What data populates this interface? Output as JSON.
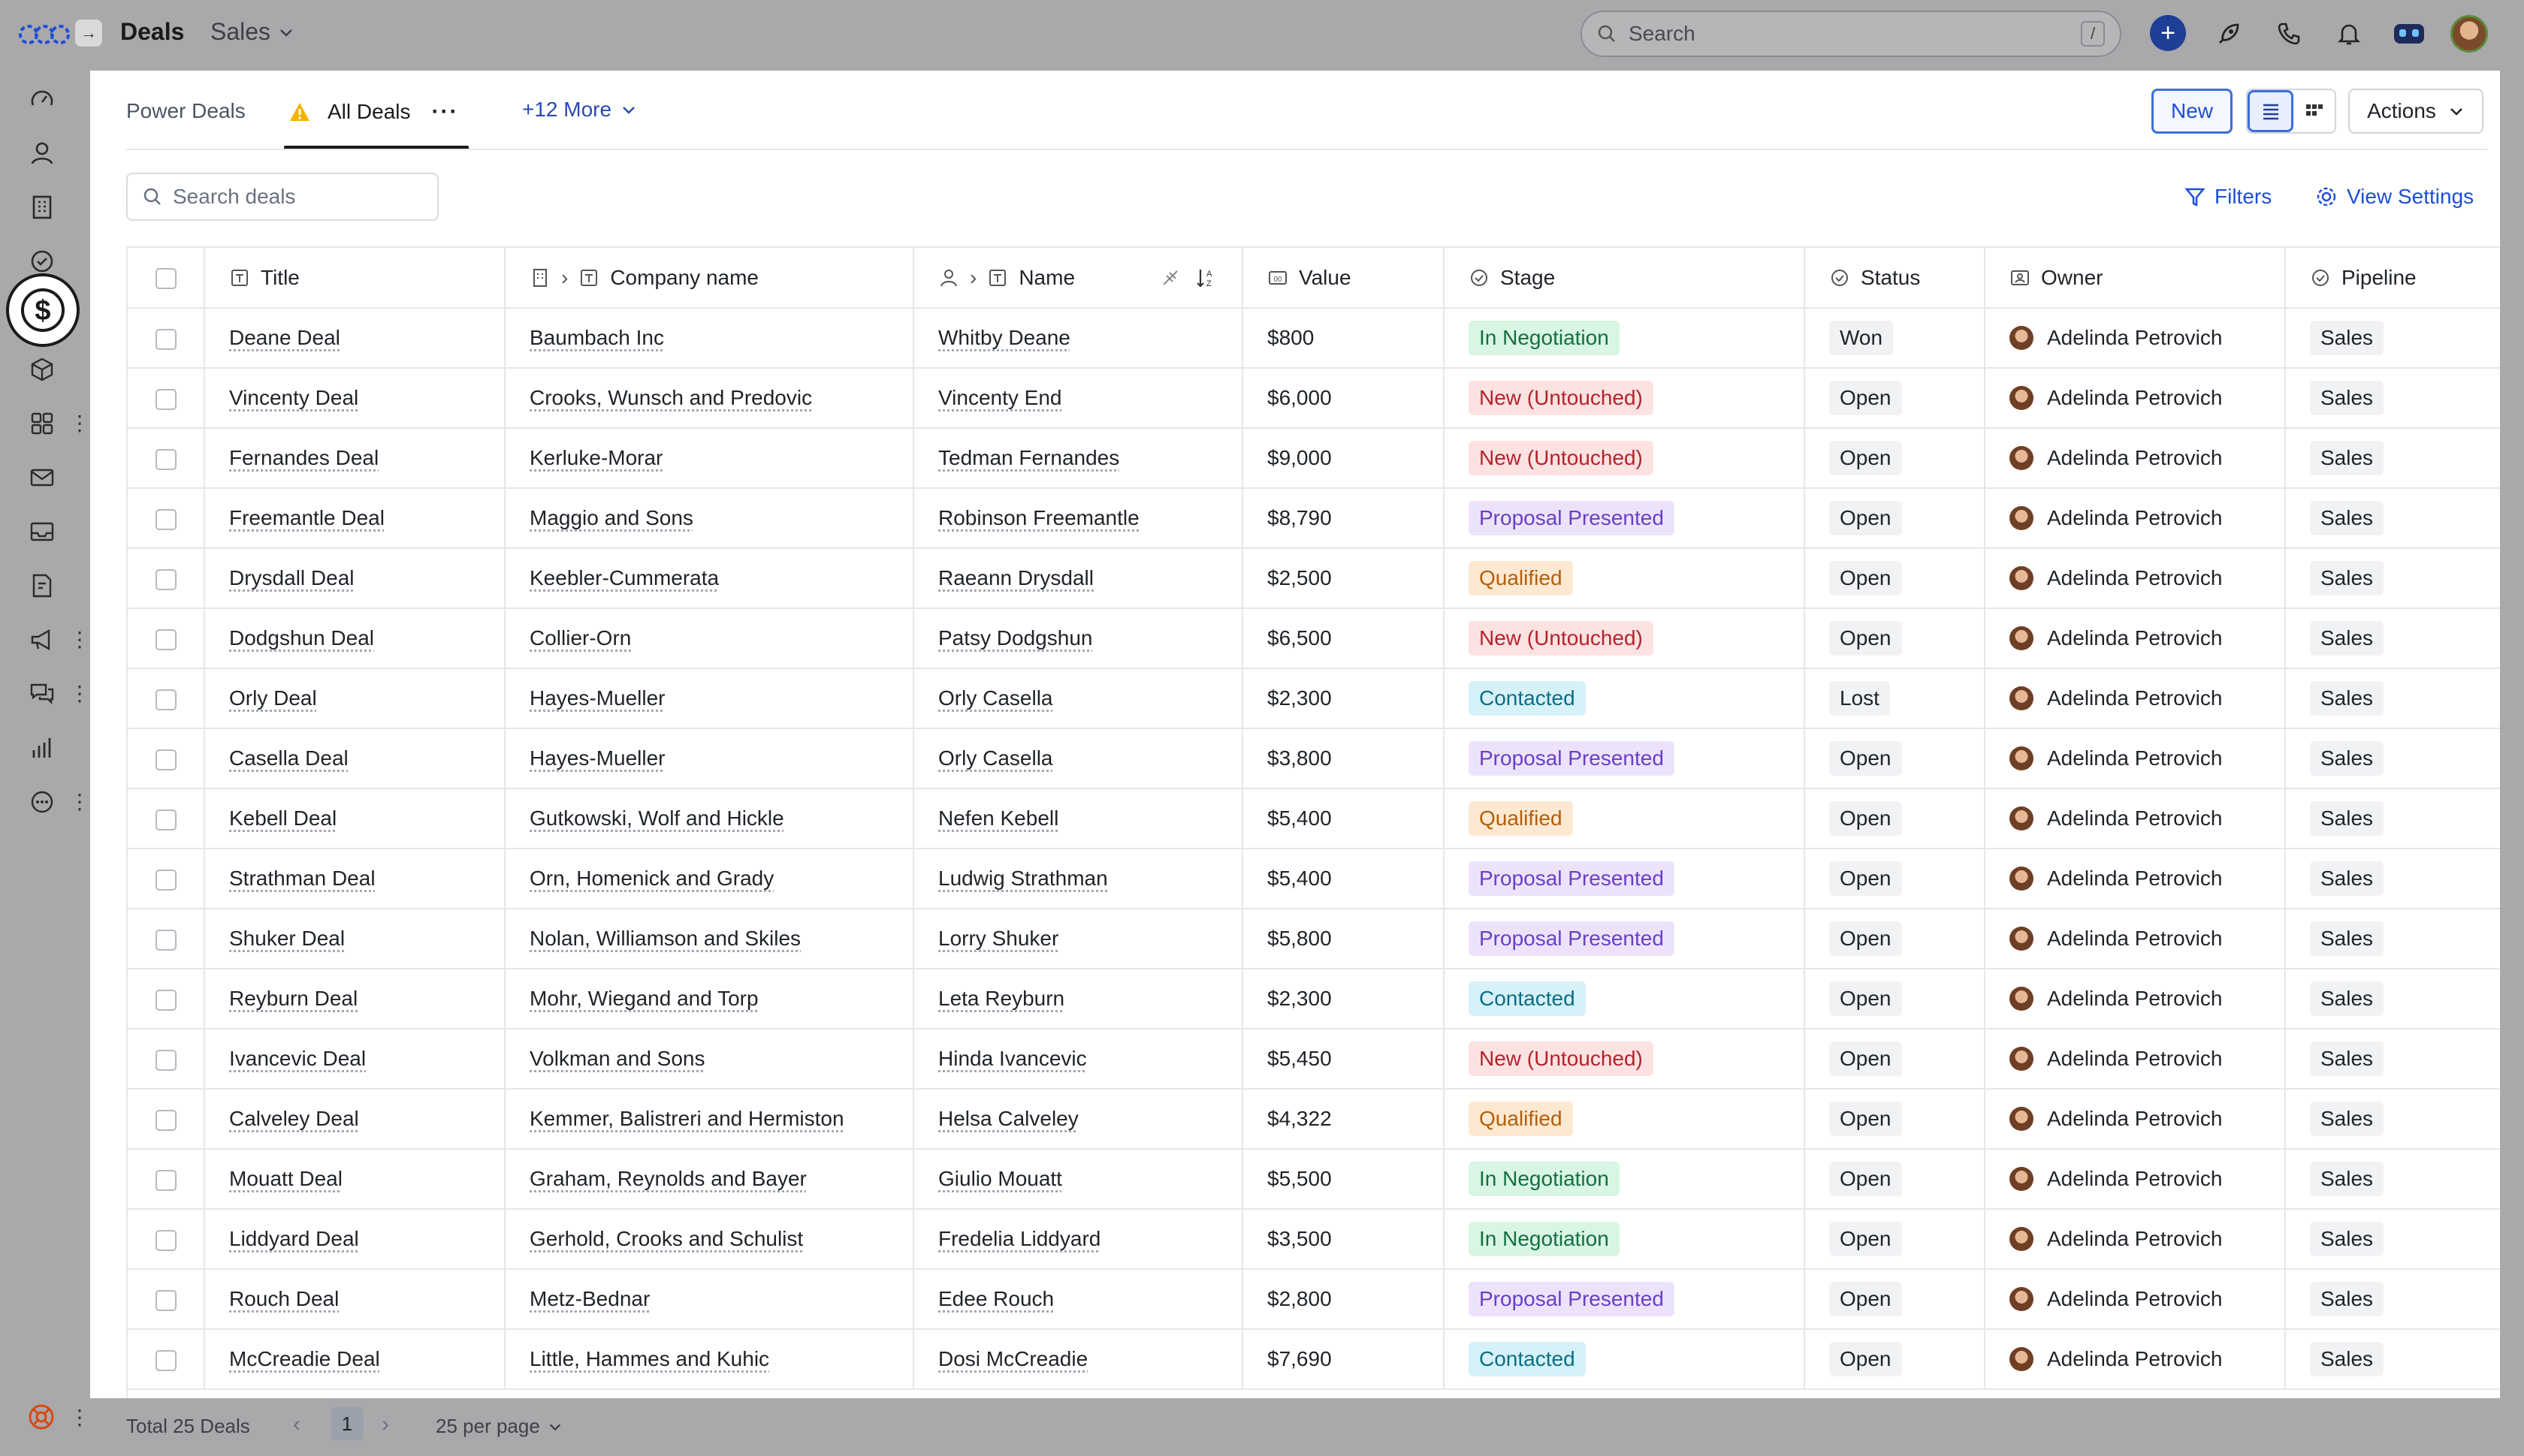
{
  "header": {
    "title": "Deals",
    "workspace": "Sales",
    "search_placeholder": "Search",
    "search_shortcut": "/"
  },
  "tabs": {
    "items": [
      {
        "label": "Power Deals"
      },
      {
        "label": "All Deals"
      }
    ],
    "more_label": "+12 More"
  },
  "toolbar": {
    "new_label": "New",
    "actions_label": "Actions",
    "search_placeholder": "Search deals",
    "filters_label": "Filters",
    "view_settings_label": "View Settings"
  },
  "table": {
    "columns": [
      "Title",
      "Company name",
      "Name",
      "Value",
      "Stage",
      "Status",
      "Owner",
      "Pipeline"
    ],
    "rows": [
      {
        "title": "Deane Deal",
        "company": "Baumbach Inc",
        "name": "Whitby Deane",
        "value": "$800",
        "stage": "In Negotiation",
        "status": "Won",
        "owner": "Adelinda Petrovich",
        "pipeline": "Sales"
      },
      {
        "title": "Vincenty Deal",
        "company": "Crooks, Wunsch and Predovic",
        "name": "Vincenty End",
        "value": "$6,000",
        "stage": "New (Untouched)",
        "status": "Open",
        "owner": "Adelinda Petrovich",
        "pipeline": "Sales"
      },
      {
        "title": "Fernandes Deal",
        "company": "Kerluke-Morar",
        "name": "Tedman Fernandes",
        "value": "$9,000",
        "stage": "New (Untouched)",
        "status": "Open",
        "owner": "Adelinda Petrovich",
        "pipeline": "Sales"
      },
      {
        "title": "Freemantle Deal",
        "company": "Maggio and Sons",
        "name": "Robinson Freemantle",
        "value": "$8,790",
        "stage": "Proposal Presented",
        "status": "Open",
        "owner": "Adelinda Petrovich",
        "pipeline": "Sales"
      },
      {
        "title": "Drysdall Deal",
        "company": "Keebler-Cummerata",
        "name": "Raeann Drysdall",
        "value": "$2,500",
        "stage": "Qualified",
        "status": "Open",
        "owner": "Adelinda Petrovich",
        "pipeline": "Sales"
      },
      {
        "title": "Dodgshun Deal",
        "company": "Collier-Orn",
        "name": "Patsy Dodgshun",
        "value": "$6,500",
        "stage": "New (Untouched)",
        "status": "Open",
        "owner": "Adelinda Petrovich",
        "pipeline": "Sales"
      },
      {
        "title": "Orly Deal",
        "company": "Hayes-Mueller",
        "name": "Orly Casella",
        "value": "$2,300",
        "stage": "Contacted",
        "status": "Lost",
        "owner": "Adelinda Petrovich",
        "pipeline": "Sales"
      },
      {
        "title": "Casella Deal",
        "company": "Hayes-Mueller",
        "name": "Orly Casella",
        "value": "$3,800",
        "stage": "Proposal Presented",
        "status": "Open",
        "owner": "Adelinda Petrovich",
        "pipeline": "Sales"
      },
      {
        "title": "Kebell Deal",
        "company": "Gutkowski, Wolf and Hickle",
        "name": "Nefen Kebell",
        "value": "$5,400",
        "stage": "Qualified",
        "status": "Open",
        "owner": "Adelinda Petrovich",
        "pipeline": "Sales"
      },
      {
        "title": "Strathman Deal",
        "company": "Orn, Homenick and Grady",
        "name": "Ludwig Strathman",
        "value": "$5,400",
        "stage": "Proposal Presented",
        "status": "Open",
        "owner": "Adelinda Petrovich",
        "pipeline": "Sales"
      },
      {
        "title": "Shuker Deal",
        "company": "Nolan, Williamson and Skiles",
        "name": "Lorry Shuker",
        "value": "$5,800",
        "stage": "Proposal Presented",
        "status": "Open",
        "owner": "Adelinda Petrovich",
        "pipeline": "Sales"
      },
      {
        "title": "Reyburn Deal",
        "company": "Mohr, Wiegand and Torp",
        "name": "Leta Reyburn",
        "value": "$2,300",
        "stage": "Contacted",
        "status": "Open",
        "owner": "Adelinda Petrovich",
        "pipeline": "Sales"
      },
      {
        "title": "Ivancevic Deal",
        "company": "Volkman and Sons",
        "name": "Hinda Ivancevic",
        "value": "$5,450",
        "stage": "New (Untouched)",
        "status": "Open",
        "owner": "Adelinda Petrovich",
        "pipeline": "Sales"
      },
      {
        "title": "Calveley Deal",
        "company": "Kemmer, Balistreri and Hermiston",
        "name": "Helsa Calveley",
        "value": "$4,322",
        "stage": "Qualified",
        "status": "Open",
        "owner": "Adelinda Petrovich",
        "pipeline": "Sales"
      },
      {
        "title": "Mouatt Deal",
        "company": "Graham, Reynolds and Bayer",
        "name": "Giulio Mouatt",
        "value": "$5,500",
        "stage": "In Negotiation",
        "status": "Open",
        "owner": "Adelinda Petrovich",
        "pipeline": "Sales"
      },
      {
        "title": "Liddyard Deal",
        "company": "Gerhold, Crooks and Schulist",
        "name": "Fredelia Liddyard",
        "value": "$3,500",
        "stage": "In Negotiation",
        "status": "Open",
        "owner": "Adelinda Petrovich",
        "pipeline": "Sales"
      },
      {
        "title": "Rouch Deal",
        "company": "Metz-Bednar",
        "name": "Edee Rouch",
        "value": "$2,800",
        "stage": "Proposal Presented",
        "status": "Open",
        "owner": "Adelinda Petrovich",
        "pipeline": "Sales"
      },
      {
        "title": "McCreadie Deal",
        "company": "Little, Hammes and Kuhic",
        "name": "Dosi McCreadie",
        "value": "$7,690",
        "stage": "Contacted",
        "status": "Open",
        "owner": "Adelinda Petrovich",
        "pipeline": "Sales"
      }
    ]
  },
  "stage_colors": {
    "In Negotiation": "#12703f",
    "New (Untouched)": "#b4232c",
    "Proposal Presented": "#6b3fc4",
    "Qualified": "#b45e09",
    "Contacted": "#0e6d85"
  },
  "footer": {
    "total_label": "Total 25 Deals",
    "current_page": "1",
    "per_page_label": "25 per page"
  },
  "accent_color": "#1d4ed8"
}
